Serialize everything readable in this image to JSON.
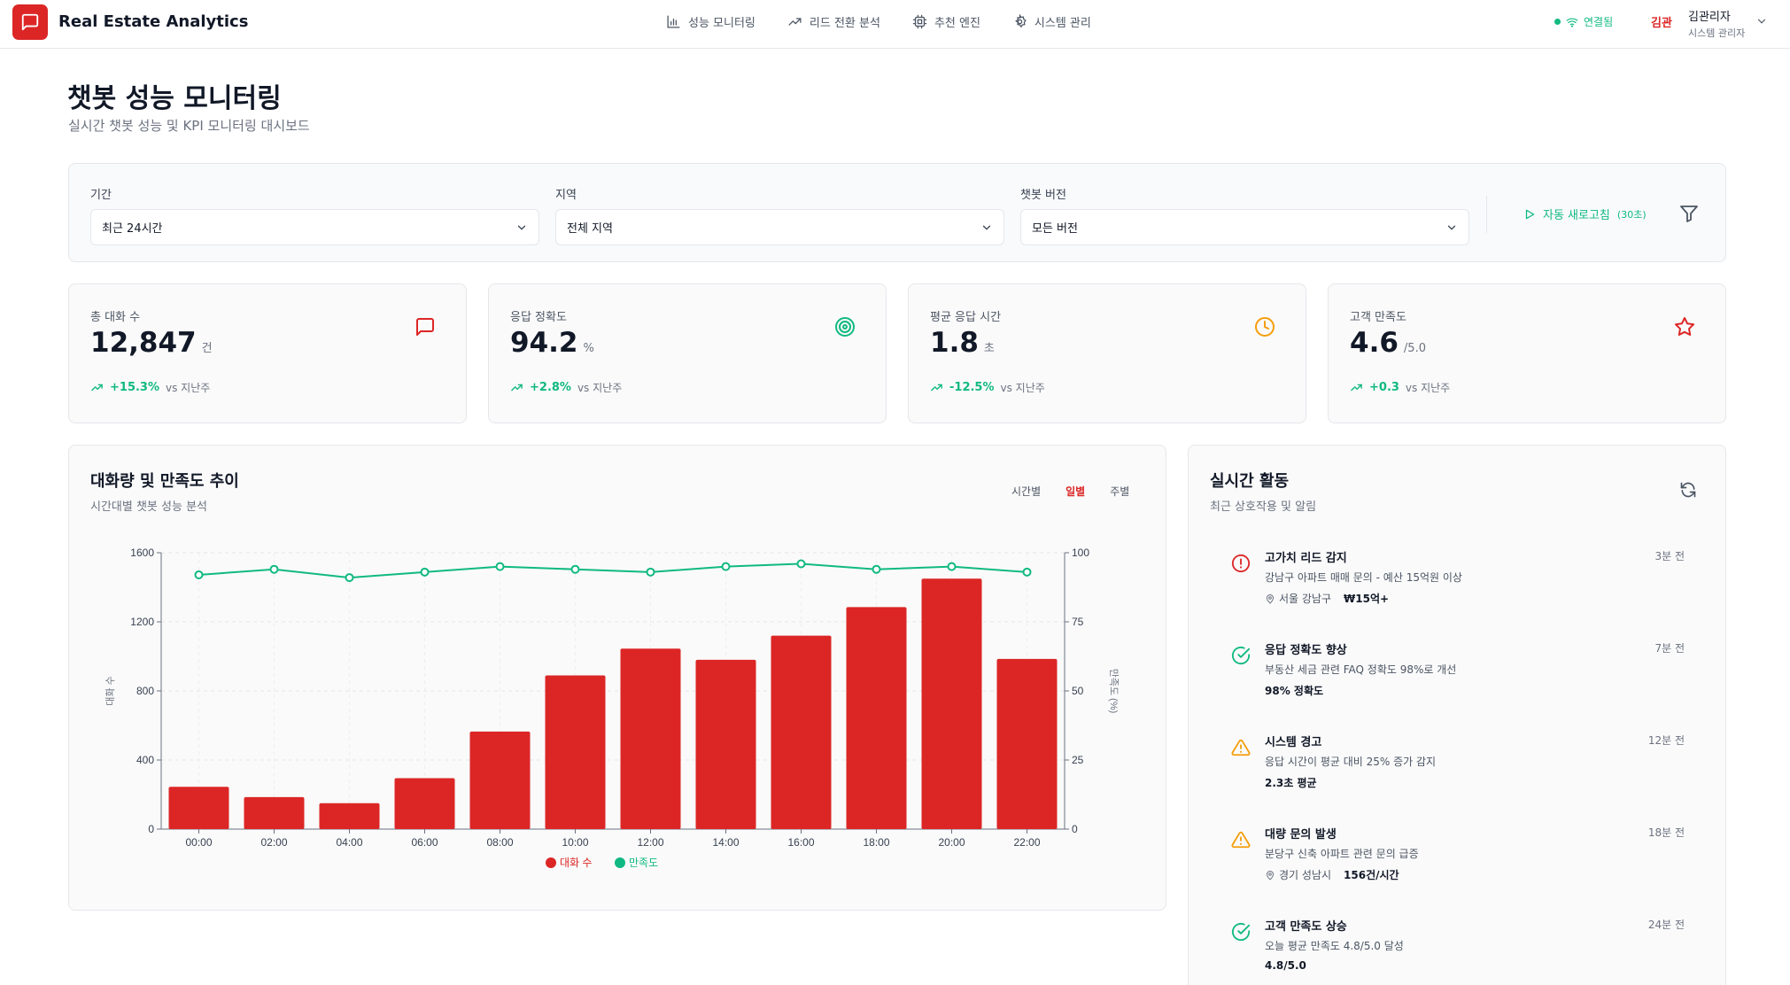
{
  "app": {
    "title": "Real Estate Analytics"
  },
  "nav": [
    {
      "label": "성능 모니터링"
    },
    {
      "label": "리드 전환 분석"
    },
    {
      "label": "추천 엔진"
    },
    {
      "label": "시스템 관리"
    }
  ],
  "status": {
    "connection": "연결됨"
  },
  "user": {
    "short": "김관",
    "name": "김관리자",
    "role": "시스템 관리자"
  },
  "page": {
    "title": "챗봇 성능 모니터링",
    "subtitle": "실시간 챗봇 성능 및 KPI 모니터링 대시보드"
  },
  "filters": {
    "period": {
      "label": "기간",
      "value": "최근 24시간"
    },
    "region": {
      "label": "지역",
      "value": "전체 지역"
    },
    "version": {
      "label": "챗봇 버전",
      "value": "모든 버전"
    },
    "auto_refresh": {
      "label": "자동 새로고침",
      "interval": "(30초)"
    }
  },
  "kpis": [
    {
      "label": "총 대화 수",
      "value": "12,847",
      "unit": "건",
      "change": "+15.3%",
      "vs": "vs 지난주",
      "icon": "message-square-icon",
      "color": "#dc2626"
    },
    {
      "label": "응답 정확도",
      "value": "94.2",
      "unit": "%",
      "change": "+2.8%",
      "vs": "vs 지난주",
      "icon": "target-icon",
      "color": "#10b981"
    },
    {
      "label": "평균 응답 시간",
      "value": "1.8",
      "unit": "초",
      "change": "-12.5%",
      "vs": "vs 지난주",
      "icon": "clock-icon",
      "color": "#f59e0b"
    },
    {
      "label": "고객 만족도",
      "value": "4.6",
      "unit": "/5.0",
      "change": "+0.3",
      "vs": "vs 지난주",
      "icon": "star-icon",
      "color": "#dc2626"
    }
  ],
  "chart_card": {
    "title": "대화량 및 만족도 추이",
    "subtitle": "시간대별 챗봇 성능 분석",
    "tabs": [
      "시간별",
      "일별",
      "주별"
    ],
    "active_tab": "일별"
  },
  "chart_data": {
    "type": "bar",
    "categories": [
      "00:00",
      "02:00",
      "04:00",
      "06:00",
      "08:00",
      "10:00",
      "12:00",
      "14:00",
      "16:00",
      "18:00",
      "20:00",
      "22:00"
    ],
    "series": [
      {
        "name": "대화 수",
        "type": "bar",
        "axis": "left",
        "color": "#dc2626",
        "values": [
          245,
          185,
          150,
          295,
          565,
          890,
          1045,
          980,
          1120,
          1285,
          1450,
          985
        ]
      },
      {
        "name": "만족도",
        "type": "line",
        "axis": "right",
        "color": "#10b981",
        "values": [
          92,
          94,
          91,
          93,
          95,
          94,
          93,
          95,
          96,
          94,
          95,
          93
        ]
      }
    ],
    "ylabel": "대화 수",
    "y2label": "만족도 (%)",
    "ylim": [
      0,
      1600
    ],
    "yticks": [
      0,
      400,
      800,
      1200,
      1600
    ],
    "y2lim": [
      0,
      100
    ],
    "y2ticks": [
      0,
      25,
      50,
      75,
      100
    ],
    "grid": true,
    "legend": "bottom-center"
  },
  "activity": {
    "title": "실시간 활동",
    "subtitle": "최근 상호작용 및 알림",
    "items": [
      {
        "icon": "alert-circle-icon",
        "color": "#dc2626",
        "title": "고가치 리드 감지",
        "desc": "강남구 아파트 매매 문의 - 예산 15억원 이상",
        "location": "서울 강남구",
        "value": "₩15억+",
        "time": "3분 전"
      },
      {
        "icon": "check-circle-icon",
        "color": "#10b981",
        "title": "응답 정확도 향상",
        "desc": "부동산 세금 관련 FAQ 정확도 98%로 개선",
        "location": "",
        "value": "98% 정확도",
        "time": "7분 전"
      },
      {
        "icon": "warning-icon",
        "color": "#f59e0b",
        "title": "시스템 경고",
        "desc": "응답 시간이 평균 대비 25% 증가 감지",
        "location": "",
        "value": "2.3초 평균",
        "time": "12분 전"
      },
      {
        "icon": "warning-icon",
        "color": "#f59e0b",
        "title": "대량 문의 발생",
        "desc": "분당구 신축 아파트 관련 문의 급증",
        "location": "경기 성남시",
        "value": "156건/시간",
        "time": "18분 전"
      },
      {
        "icon": "check-circle-icon",
        "color": "#10b981",
        "title": "고객 만족도 상승",
        "desc": "오늘 평균 만족도 4.8/5.0 달성",
        "location": "",
        "value": "4.8/5.0",
        "time": "24분 전"
      }
    ]
  }
}
